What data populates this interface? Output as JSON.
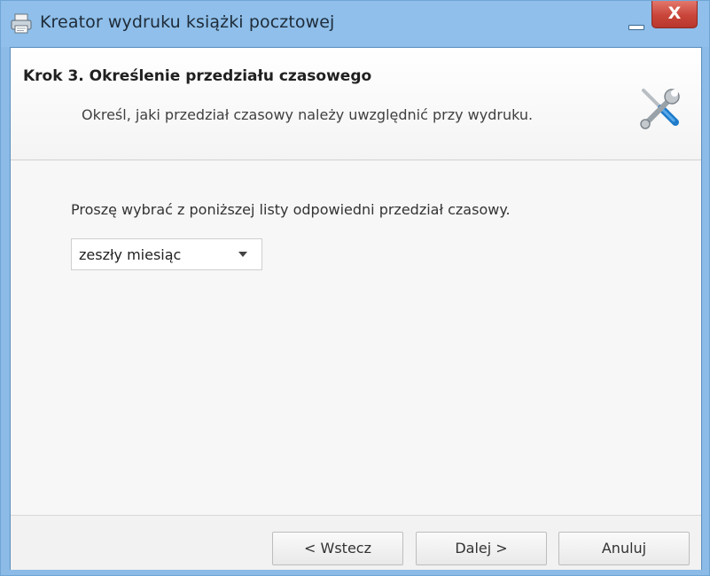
{
  "window": {
    "title": "Kreator wydruku książki pocztowej",
    "close_glyph": "X"
  },
  "header": {
    "step_title": "Krok 3. Określenie przedziału czasowego",
    "step_subtitle": "Określ, jaki przedział czasowy należy uwzględnić przy wydruku.",
    "icon": "tools-icon"
  },
  "content": {
    "prompt": "Proszę wybrać z poniższej listy odpowiedni przedział czasowy.",
    "range_select": {
      "selected": "zeszły miesiąc"
    }
  },
  "footer": {
    "back_label": "< Wstecz",
    "next_label": "Dalej >",
    "cancel_label": "Anuluj"
  },
  "colors": {
    "titlebar": "#8fbfea",
    "close_button": "#c9453a",
    "accent": "#1a73c8"
  }
}
